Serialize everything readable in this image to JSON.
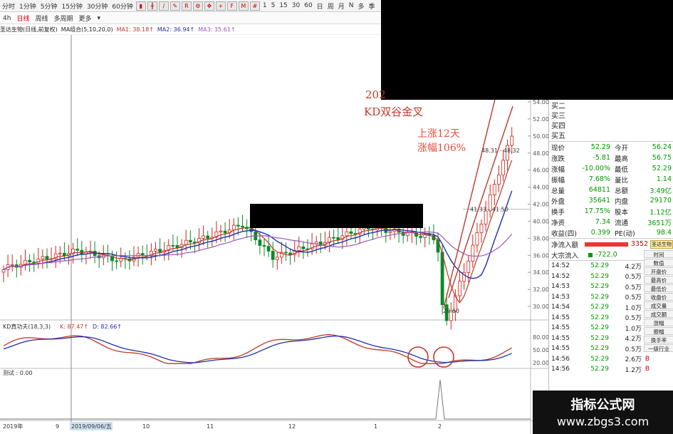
{
  "toolbar": {
    "tools": [
      "分时",
      "1分钟",
      "5分钟",
      "15分钟",
      "30分钟",
      "60分钟",
      "4h",
      "日线",
      "周线",
      "多周期",
      "更多"
    ],
    "icons": [
      "bar-icon",
      "kline-icon",
      "line-icon",
      "draw-icon",
      "rsi-icon",
      "gear-icon",
      "move-icon",
      "cross-icon",
      "fs-icon",
      "ma-icon",
      "grid-icon",
      "1",
      "5",
      "15",
      "30",
      "60",
      "日",
      "周",
      "月",
      "N",
      "多",
      "季"
    ]
  },
  "period_buttons": [
    "1",
    "5",
    "15",
    "30",
    "60",
    "日",
    "周",
    "月",
    "N",
    "多",
    "季"
  ],
  "active_tool": "日线",
  "ma_bar": {
    "title": "圣达生物(日线,前复权)",
    "indicator": "MA组合(5,10,20,0)",
    "ma1": "MA1: 38.18↑",
    "ma2": "MA2: 36.94↑",
    "ma3": "MA3: 35.61↑"
  },
  "annotations": {
    "title_prefix": "202",
    "kd_text": "KD双谷金叉",
    "rise_days": "上涨12天",
    "rise_pct": "涨幅106%"
  },
  "price_axis": [
    "54.00",
    "52.00",
    "50.00",
    "48.00",
    "46.00",
    "44.00",
    "42.00",
    "40.00",
    "38.00",
    "36.00",
    "34.00",
    "32.00",
    "30.00"
  ],
  "price_labels": {
    "low": "29.60",
    "ref1": "48.31 - 48.32",
    "ref2": "41.33 - 41.50"
  },
  "kd_bar": {
    "title": "KD真功夫(18,3,3)",
    "k": "K: 87.47↑",
    "d": "D: 82.66↑"
  },
  "kd_axis": [
    "80.00",
    "50.00",
    "20.00"
  ],
  "test_bar": {
    "title": "测试 : 0.00"
  },
  "date_axis": [
    "2019年",
    "9",
    "2019/09/06/五",
    "10",
    "11",
    "12",
    "1",
    "2"
  ],
  "order_book": [
    "买二",
    "买三",
    "买四",
    "买五"
  ],
  "quote": [
    {
      "l": "现价",
      "v1": "52.29",
      "l2": "今开",
      "v2": "56.24"
    },
    {
      "l": "涨跌",
      "v1": "-5.81",
      "l2": "最高",
      "v2": "56.75"
    },
    {
      "l": "涨幅",
      "v1": "-10.00%",
      "l2": "最低",
      "v2": "52.29"
    },
    {
      "l": "振幅",
      "v1": "7.68%",
      "l2": "量比",
      "v2": "1.14"
    },
    {
      "l": "总量",
      "v1": "64811",
      "l2": "总额",
      "v2": "3.49亿"
    },
    {
      "l": "外盘",
      "v1": "35641",
      "l2": "内盘",
      "v2": "29170"
    },
    {
      "l": "换手",
      "v1": "17.75%",
      "l2": "股本",
      "v2": "1.12亿"
    },
    {
      "l": "净资",
      "v1": "7.34",
      "l2": "流通",
      "v2": "3651万"
    },
    {
      "l": "收益(四)",
      "v1": "0.399",
      "l2": "PE(动)",
      "v2": "98.4"
    }
  ],
  "flow": [
    {
      "l": "净流入额",
      "v": "3352"
    },
    {
      "l": "大宗流入",
      "v": "-722.0"
    }
  ],
  "stock_tag": "圣达生物",
  "ticks": [
    {
      "t": "14:52",
      "p": "52.29",
      "v": "4.2万",
      "f": ""
    },
    {
      "t": "14:52",
      "p": "52.29",
      "v": "0.5万",
      "f": ""
    },
    {
      "t": "14:53",
      "p": "52.29",
      "v": "0.5万",
      "f": ""
    },
    {
      "t": "14:53",
      "p": "52.29",
      "v": "0.5万",
      "f": ""
    },
    {
      "t": "14:54",
      "p": "52.29",
      "v": "1.0万",
      "f": ""
    },
    {
      "t": "14:55",
      "p": "52.29",
      "v": "0.5万",
      "f": ""
    },
    {
      "t": "14:55",
      "p": "52.29",
      "v": "1.0万",
      "f": ""
    },
    {
      "t": "14:55",
      "p": "52.29",
      "v": "4.2万",
      "f": ""
    },
    {
      "t": "14:55",
      "p": "52.29",
      "v": "0.5万",
      "f": ""
    },
    {
      "t": "14:56",
      "p": "52.29",
      "v": "2.6万",
      "f": "B"
    },
    {
      "t": "14:56",
      "p": "52.29",
      "v": "1.2万",
      "f": "B"
    }
  ],
  "side_buttons": [
    "时间",
    "数值",
    "开盘价",
    "最高价",
    "最低价",
    "收盘价",
    "成交量",
    "成交额",
    "涨幅",
    "振幅",
    "换手率",
    "一级行业"
  ],
  "watermark": {
    "line1": "指标公式网",
    "line2": "www.zbgs3.com"
  },
  "colors": {
    "up": "#d0241b",
    "down": "#0a8a2a",
    "ma1": "#c0392b",
    "ma2": "#1f2fa8",
    "ma3": "#9b59b6",
    "kd_k": "#c0392b",
    "kd_d": "#1f2fa8"
  }
}
